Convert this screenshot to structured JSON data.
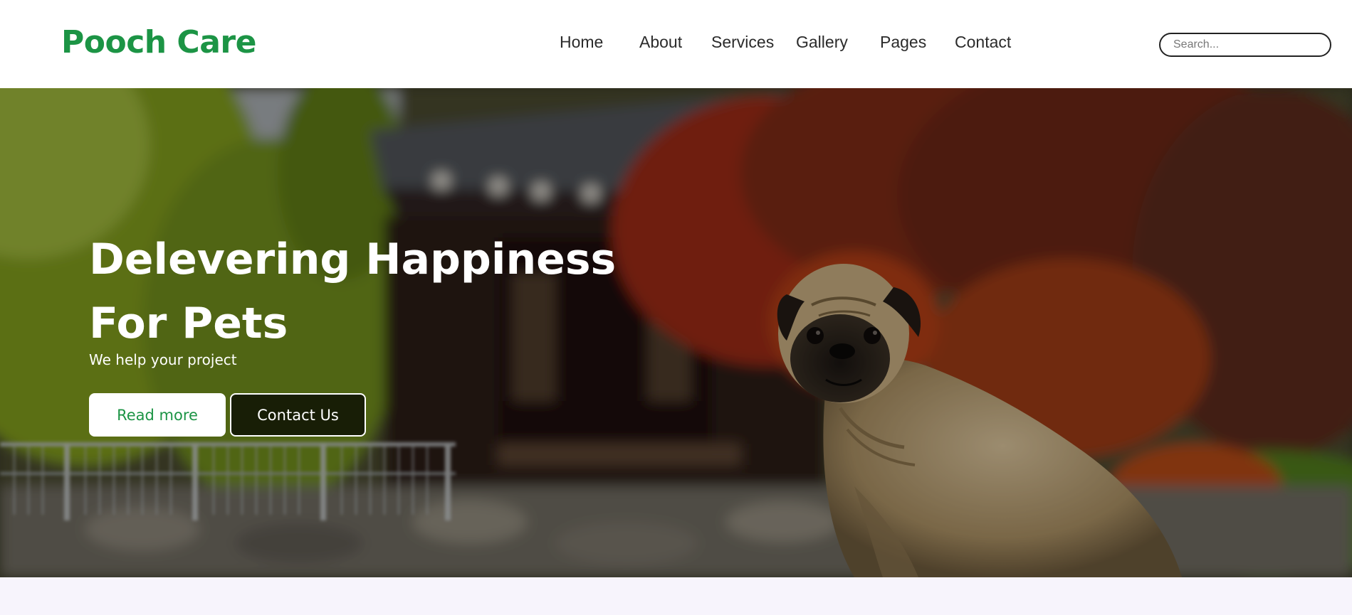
{
  "brand": {
    "name": "Pooch Care",
    "color": "#1c9445"
  },
  "nav": {
    "items": [
      {
        "label": "Home"
      },
      {
        "label": "About"
      },
      {
        "label": "Services"
      },
      {
        "label": "Gallery"
      },
      {
        "label": "Pages"
      },
      {
        "label": "Contact"
      }
    ]
  },
  "search": {
    "placeholder": "Search...",
    "value": ""
  },
  "hero": {
    "title_line1": "Delevering Happiness",
    "title_line2": "For Pets",
    "subtitle": "We help your project",
    "primary_button": "Read more",
    "secondary_button": "Contact Us",
    "image": "pug-sitting-in-front-of-traditional-house-garden-autumn"
  },
  "colors": {
    "accent": "#1c9445",
    "page_background": "#f7f4fc",
    "header_background": "#ffffff"
  }
}
